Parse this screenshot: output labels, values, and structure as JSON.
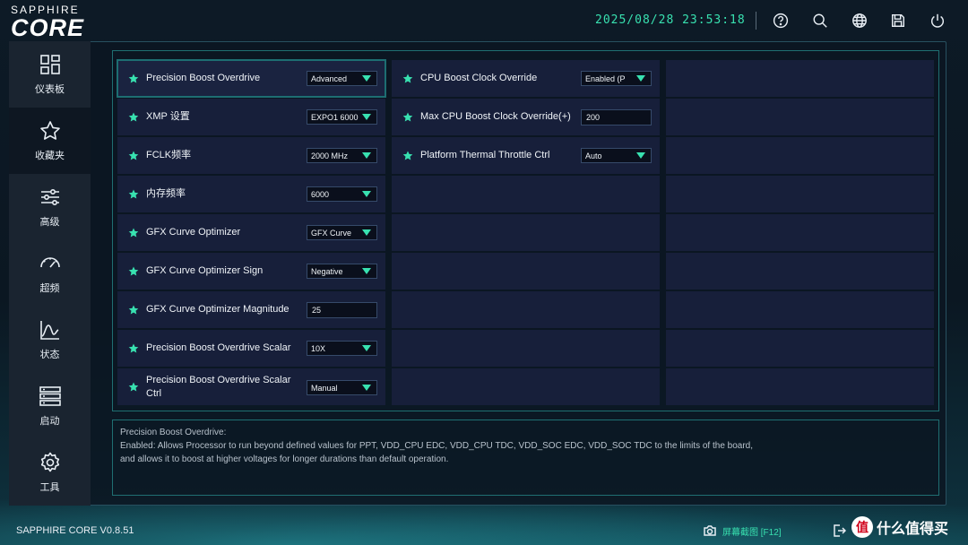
{
  "header": {
    "brand_top": "SAPPHIRE",
    "brand_main": "CORE",
    "datetime": "2025/08/28 23:53:18"
  },
  "sidebar": {
    "items": [
      {
        "label": "仪表板",
        "icon": "dashboard-icon"
      },
      {
        "label": "收藏夹",
        "icon": "star-icon"
      },
      {
        "label": "高级",
        "icon": "sliders-icon"
      },
      {
        "label": "超频",
        "icon": "gauge-icon"
      },
      {
        "label": "状态",
        "icon": "chart-icon"
      },
      {
        "label": "启动",
        "icon": "boot-list-icon"
      },
      {
        "label": "工具",
        "icon": "gear-icon"
      }
    ]
  },
  "settings_left": [
    {
      "label": "Precision Boost Overdrive",
      "value": "Advanced",
      "control": "dropdown"
    },
    {
      "label": "XMP 设置",
      "value": "EXPO1 6000",
      "control": "dropdown"
    },
    {
      "label": "FCLK频率",
      "value": "2000 MHz",
      "control": "dropdown"
    },
    {
      "label": "内存频率",
      "value": "6000",
      "control": "dropdown"
    },
    {
      "label": "GFX Curve Optimizer",
      "value": "GFX Curve",
      "control": "dropdown"
    },
    {
      "label": "GFX Curve Optimizer Sign",
      "value": "Negative",
      "control": "dropdown"
    },
    {
      "label": "GFX Curve Optimizer Magnitude",
      "value": "25",
      "control": "input"
    },
    {
      "label": "Precision Boost Overdrive Scalar",
      "value": "10X",
      "control": "dropdown"
    },
    {
      "label": "Precision Boost Overdrive Scalar Ctrl",
      "value": "Manual",
      "control": "dropdown"
    }
  ],
  "settings_mid": [
    {
      "label": "CPU Boost Clock Override",
      "value": "Enabled (P",
      "control": "dropdown"
    },
    {
      "label": "Max CPU Boost Clock Override(+)",
      "value": "200",
      "control": "input"
    },
    {
      "label": "Platform Thermal Throttle Ctrl",
      "value": "Auto",
      "control": "dropdown"
    }
  ],
  "description": {
    "title": "Precision Boost Overdrive:",
    "line1": " Enabled: Allows Processor to run beyond defined values for PPT, VDD_CPU EDC, VDD_CPU TDC, VDD_SOC EDC, VDD_SOC TDC to the limits of the board,",
    "line2": "and allows it to boost at higher voltages for longer durations than default operation."
  },
  "footer": {
    "version": "SAPPHIRE CORE V0.8.51",
    "screenshot_label": "屏幕截图 [F12]",
    "watermark": "什么值得买"
  },
  "colors": {
    "accent": "#38e1b0",
    "cell_bg": "#171f3a",
    "panel_border": "#1f6f72"
  }
}
